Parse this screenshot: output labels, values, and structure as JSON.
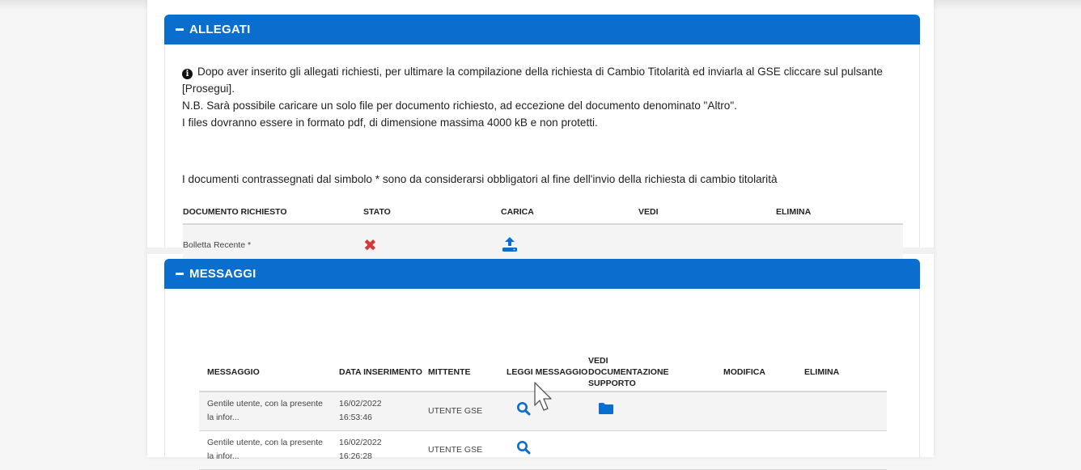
{
  "allegati": {
    "title": "ALLEGATI",
    "info_line1": "Dopo aver inserito gli allegati richiesti, per ultimare la compilazione della richiesta di Cambio Titolarità ed inviarla al GSE cliccare sul pulsante",
    "info_line2": "[Prosegui].",
    "info_line3": "N.B. Sarà possibile caricare un solo file per documento richiesto, ad eccezione del documento denominato \"Altro\".",
    "info_line4": "I files dovranno essere in formato pdf, di dimensione massima 4000 kB e non protetti.",
    "mandatory_note": "I documenti contrassegnati dal simbolo * sono da considerarsi obbligatori al fine dell'invio della richiesta di cambio titolarità",
    "columns": [
      "DOCUMENTO RICHIESTO",
      "STATO",
      "CARICA",
      "VEDI",
      "ELIMINA"
    ],
    "rows": [
      {
        "documento": "Bolletta Recente *",
        "stato_icon": "x-mark-icon",
        "carica_icon": "upload-icon"
      }
    ]
  },
  "messaggi": {
    "title": "MESSAGGI",
    "columns": [
      "MESSAGGIO",
      "DATA INSERIMENTO",
      "MITTENTE",
      "LEGGI MESSAGGIO",
      "VEDI DOCUMENTAZIONE SUPPORTO",
      "MODIFICA",
      "ELIMINA"
    ],
    "rows": [
      {
        "messaggio": "Gentile utente, con la presente la infor...",
        "data": "16/02/2022",
        "ora": "16:53:46",
        "mittente": "UTENTE GSE",
        "leggi_icon": "search-icon",
        "vedi_icon": "folder-icon"
      },
      {
        "messaggio": "Gentile utente, con la presente la infor...",
        "data": "16/02/2022",
        "ora": "16:26:28",
        "mittente": "UTENTE GSE",
        "leggi_icon": "search-icon"
      }
    ]
  },
  "colors": {
    "header_blue": "#0a6ece",
    "icon_blue": "#0a6ece",
    "error_red": "#d33b3b"
  }
}
